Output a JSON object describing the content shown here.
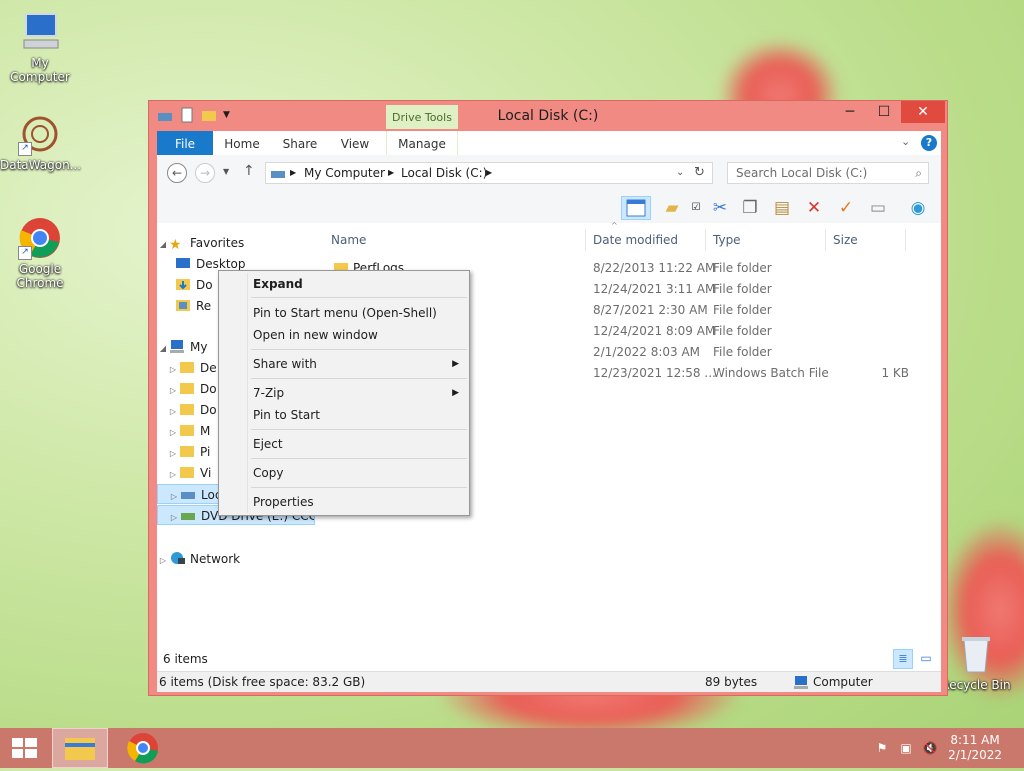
{
  "desktop": {
    "icons": [
      {
        "label": "My Computer"
      },
      {
        "label": "DataWagon..."
      },
      {
        "label": "Google Chrome"
      },
      {
        "label": "Recycle Bin"
      }
    ]
  },
  "window": {
    "title": "Local Disk (C:)",
    "contextual_tab_group": "Drive Tools",
    "controls": {
      "minimize": "─",
      "maximize": "☐",
      "close": "✕"
    },
    "tabs": [
      {
        "label": "File"
      },
      {
        "label": "Home"
      },
      {
        "label": "Share"
      },
      {
        "label": "View"
      },
      {
        "label": "Manage"
      }
    ],
    "address": {
      "segments": [
        "My Computer",
        "Local Disk (C:)"
      ],
      "search_placeholder": "Search Local Disk (C:)"
    },
    "nav_pane": {
      "items": [
        {
          "label": "Favorites",
          "icon": "star-icon"
        },
        {
          "label": "Desktop",
          "icon": "desktop-icon"
        },
        {
          "label": "Do",
          "icon": "downloads-icon"
        },
        {
          "label": "Re",
          "icon": "recent-places-icon"
        },
        {
          "label": "My",
          "icon": "computer-icon"
        },
        {
          "label": "De",
          "icon": "folder-icon"
        },
        {
          "label": "Do",
          "icon": "folder-icon"
        },
        {
          "label": "Do",
          "icon": "folder-icon"
        },
        {
          "label": "M",
          "icon": "folder-icon"
        },
        {
          "label": "Pi",
          "icon": "folder-icon"
        },
        {
          "label": "Vi",
          "icon": "folder-icon"
        },
        {
          "label": "Loc",
          "icon": "drive-icon"
        },
        {
          "label": "DVD Drive (E:) CCCC",
          "icon": "dvd-drive-icon"
        },
        {
          "label": "Network",
          "icon": "network-icon"
        }
      ]
    },
    "columns": [
      "Name",
      "Date modified",
      "Type",
      "Size"
    ],
    "files": [
      {
        "name": "PerfLogs",
        "date": "8/22/2013 11:22 AM",
        "type": "File folder",
        "size": ""
      },
      {
        "name": "",
        "date": "12/24/2021 3:11 AM",
        "type": "File folder",
        "size": ""
      },
      {
        "name": "",
        "date": "8/27/2021 2:30 AM",
        "type": "File folder",
        "size": ""
      },
      {
        "name": "",
        "date": "12/24/2021 8:09 AM",
        "type": "File folder",
        "size": ""
      },
      {
        "name": "",
        "date": "2/1/2022 8:03 AM",
        "type": "File folder",
        "size": ""
      },
      {
        "name": "",
        "date": "12/23/2021 12:58 ...",
        "type": "Windows Batch File",
        "size": "1 KB"
      }
    ],
    "status": {
      "item_count": "6 items",
      "detail": "6 items (Disk free space: 83.2 GB)",
      "size": "89 bytes",
      "location": "Computer"
    }
  },
  "context_menu": {
    "items": [
      {
        "label": "Expand",
        "bold": true
      },
      {
        "label": "Pin to Start menu (Open-Shell)"
      },
      {
        "label": "Open in new window"
      },
      {
        "label": "Share with",
        "submenu": true
      },
      {
        "label": "7-Zip",
        "submenu": true
      },
      {
        "label": "Pin to Start"
      },
      {
        "label": "Eject"
      },
      {
        "label": "Copy"
      },
      {
        "label": "Properties"
      }
    ]
  },
  "taskbar": {
    "time": "8:11 AM",
    "date": "2/1/2022"
  },
  "colors": {
    "window_frame": "#f08a83",
    "file_tab": "#1979ca",
    "drive_tools": "#dff0c4",
    "taskbar": "#c9786b",
    "close_button": "#e04a3f"
  }
}
